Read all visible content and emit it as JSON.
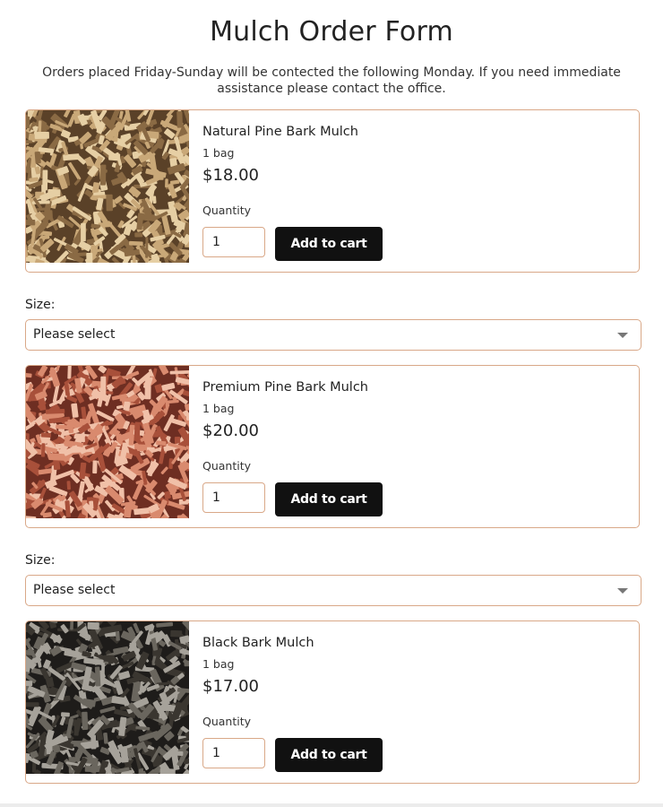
{
  "page": {
    "title": "Mulch Order Form",
    "notice": "Orders placed Friday-Sunday will be contected the following Monday. If you need immediate assistance please contact the office."
  },
  "products": [
    {
      "name": "Natural Pine Bark Mulch",
      "unit": "1 bag",
      "price": "$18.00",
      "quantity_label": "Quantity",
      "quantity_value": "1",
      "add_to_cart_label": "Add to cart",
      "image_icon": "natural-pine-mulch-image",
      "image_colors": [
        "#8a6a44",
        "#c9a878",
        "#e6cfa4",
        "#5a4128"
      ]
    },
    {
      "name": "Premium Pine Bark Mulch",
      "unit": "1 bag",
      "price": "$20.00",
      "quantity_label": "Quantity",
      "quantity_value": "1",
      "add_to_cart_label": "Add to cart",
      "image_icon": "premium-pine-mulch-image",
      "image_colors": [
        "#a8503a",
        "#d98a6e",
        "#f0c0a8",
        "#6e2e22"
      ]
    },
    {
      "name": "Black Bark Mulch",
      "unit": "1 bag",
      "price": "$17.00",
      "quantity_label": "Quantity",
      "quantity_value": "1",
      "add_to_cart_label": "Add to cart",
      "image_icon": "black-bark-mulch-image",
      "image_colors": [
        "#3a3630",
        "#6a665e",
        "#a6a29a",
        "#1e1c1a"
      ]
    }
  ],
  "size_selects": [
    {
      "label": "Size:",
      "value": "Please select"
    },
    {
      "label": "Size:",
      "value": "Please select"
    }
  ],
  "colors": {
    "border_accent": "#d9a888",
    "button_bg": "#111111",
    "button_text": "#ffffff"
  }
}
